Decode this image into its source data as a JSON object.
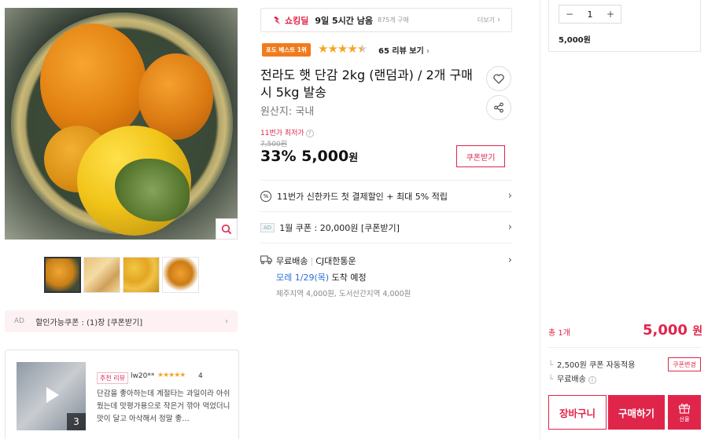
{
  "deal": {
    "name": "쇼킹딜",
    "time_left": "9일 5시간 남음",
    "purchase_count": "875개 구매",
    "more_label": "더보기"
  },
  "product": {
    "best_badge": "포도 베스트 1위",
    "rating": 4.5,
    "review_link": "65 리뷰 보기",
    "title": "전라도 햇 단감 2kg (랜덤과) / 2개 구매시 5kg 발송",
    "origin": "원산지: 국내"
  },
  "price": {
    "lowest_label": "11번가 최저가",
    "original": "7,500원",
    "discount": "33%",
    "current": "5,000",
    "currency": "원",
    "coupon_button": "쿠폰받기"
  },
  "benefits": {
    "card_icon_text": "%",
    "card_text": "11번가 신한카드 첫 결제할인 + 최대 5% 적립",
    "ad_tag": "AD",
    "monthly_coupon": "1월 쿠폰 : 20,000원 [쿠폰받기]"
  },
  "shipping": {
    "type": "무료배송",
    "carrier": "CJ대한통운",
    "date_blue": "모레 1/29(목)",
    "date_suffix": "도착 예정",
    "extra": "제주지역 4,000원, 도서산간지역 4,000원"
  },
  "left": {
    "coupon_ad": "AD",
    "coupon_text": "할인가능쿠폰 : (1)장 [쿠폰받기]"
  },
  "review": {
    "badge": "추천 리뷰",
    "user": "lw20**",
    "stars": "★★★★★",
    "score": "4",
    "media_count": "3",
    "text": "단감을 좋아하는데 계절타는 과일이라 아쉬웠는데 맛평가용으로 작은거 깎아 먹었더니 맛이 달고 아삭해서 정말 좋…"
  },
  "order": {
    "quantity": "1",
    "option_price": "5,000원",
    "total_label": "총 1개",
    "total_price": "5,000",
    "total_won": "원",
    "auto_coupon": "2,500원 쿠폰 자동적용",
    "coupon_change": "쿠폰변경",
    "free_shipping": "무료배송",
    "cart_button": "장바구니",
    "buy_button": "구매하기",
    "gift_button": "선물"
  },
  "colors": {
    "accent": "#e0254b",
    "star": "#f5a623",
    "badge": "#f07b1e",
    "link_blue": "#2b6fd6"
  }
}
